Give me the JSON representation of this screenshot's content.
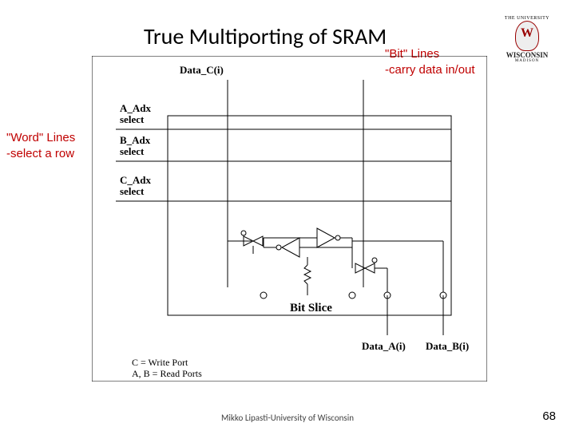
{
  "title": "True Multiporting of SRAM",
  "logo_top": "THE UNIVERSITY",
  "logo_bottom": "WISCONSIN",
  "logo_sub": "MADISON",
  "word_lines": {
    "l1": "\"Word\" Lines",
    "l2": "-select a row"
  },
  "bit_lines": {
    "l1": "\"Bit\" Lines",
    "l2": "-carry data in/out"
  },
  "labels": {
    "data_c": "Data_C(i)",
    "a_adx1": "A_Adx",
    "a_adx2": "select",
    "b_adx1": "B_Adx",
    "b_adx2": "select",
    "c_adx1": "C_Adx",
    "c_adx2": "select",
    "data_a": "Data_A(i)",
    "data_b": "Data_B(i)",
    "bit_slice": "Bit Slice",
    "leg1": "C = Write Port",
    "leg2": "A, B = Read Ports"
  },
  "footer": "Mikko Lipasti-University of Wisconsin",
  "pagenum": "68"
}
